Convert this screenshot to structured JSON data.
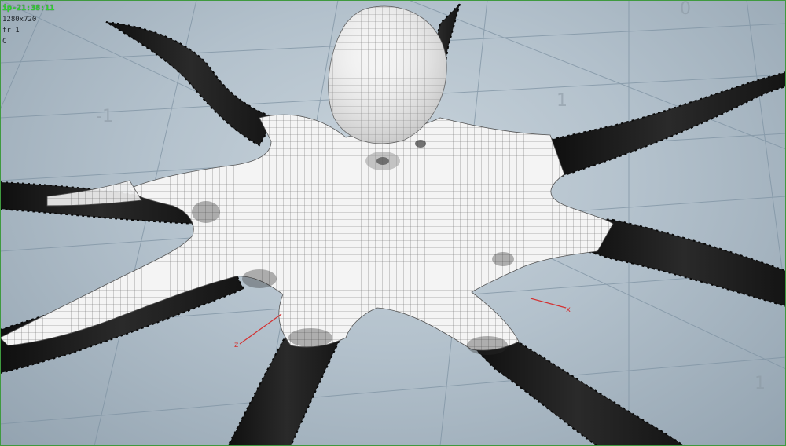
{
  "hud": {
    "title": "ip-21:38:11",
    "resolution": "1280x720",
    "frame": "fr 1",
    "camera": "C"
  },
  "axes": {
    "x_label": "x",
    "z_label": "z"
  },
  "colors": {
    "frame_border": "#3f9a3f",
    "hud_title": "#2fd12f",
    "axis": "#d43030",
    "grid_line": "#7f93a3",
    "mesh_fill": "#f3f3f3",
    "tentacle_dark": "#1b1b1b"
  },
  "scene": {
    "object": "octopus-mesh",
    "tentacle_count": 8
  }
}
